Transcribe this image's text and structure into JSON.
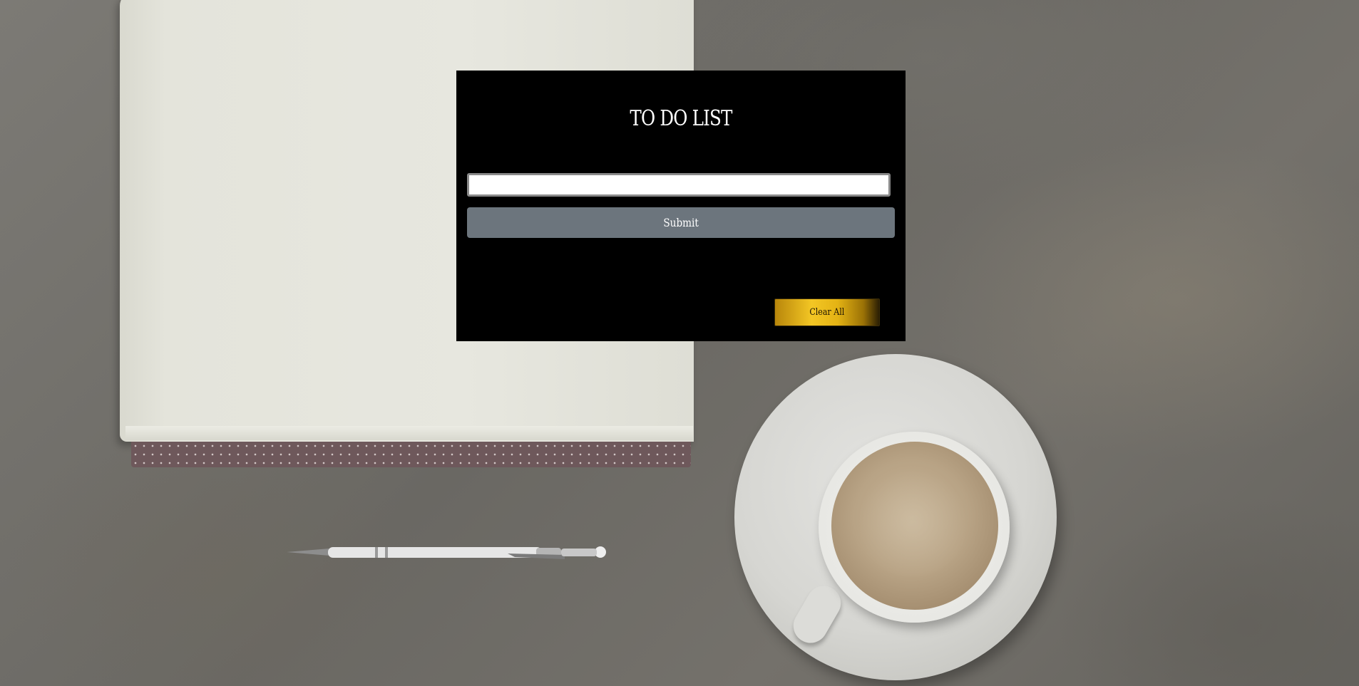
{
  "app": {
    "title": "TO DO LIST",
    "input": {
      "value": "",
      "placeholder": ""
    },
    "submit_label": "Submit",
    "tasks": [],
    "clear_label": "Clear All"
  },
  "colors": {
    "panel_background": "#000000",
    "title_text": "#ffffff",
    "submit_background": "#6c757d",
    "submit_text": "#ffffff",
    "clear_gradient_start": "#b8860b",
    "clear_gradient_mid": "#f3c624",
    "clear_gradient_end": "#2a1e04"
  },
  "background_image": {
    "objects": [
      "notebook",
      "pen",
      "coffee-cup",
      "saucer",
      "concrete-surface"
    ]
  }
}
